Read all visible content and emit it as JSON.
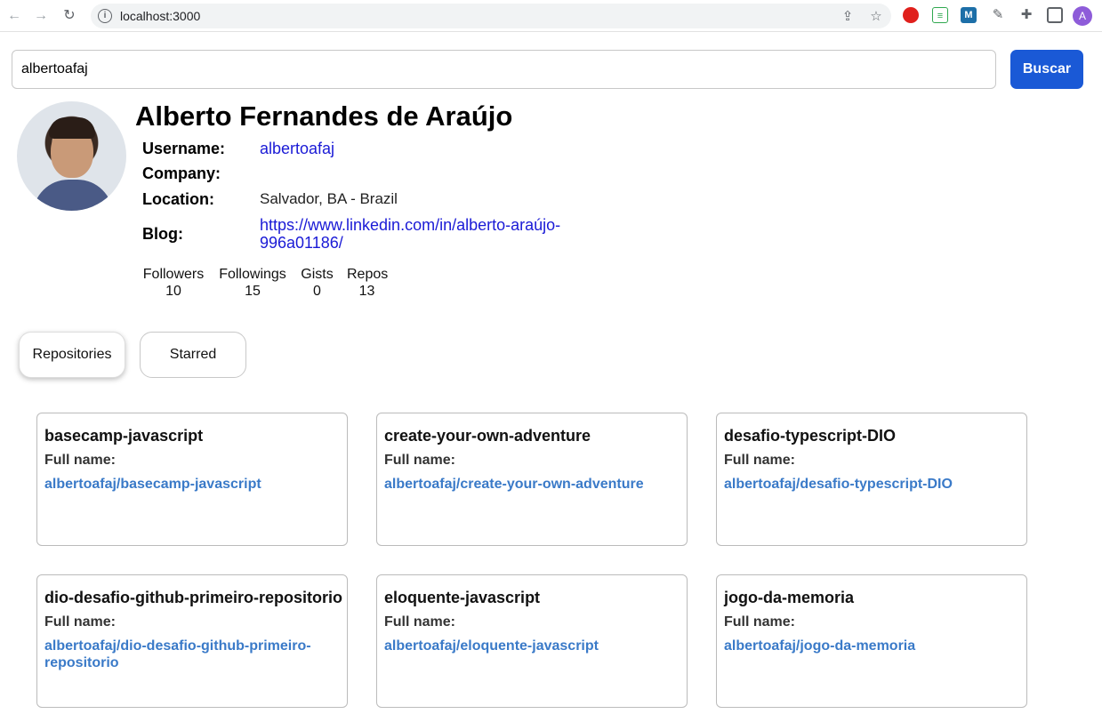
{
  "browser": {
    "url": "localhost:3000",
    "profile_initial": "A"
  },
  "search": {
    "value": "albertoafaj",
    "button_label": "Buscar"
  },
  "profile": {
    "name": "Alberto Fernandes de Araújo",
    "fields": {
      "username_label": "Username:",
      "username_value": "albertoafaj",
      "company_label": "Company:",
      "company_value": "",
      "location_label": "Location:",
      "location_value": "Salvador, BA - Brazil",
      "blog_label": "Blog:",
      "blog_value": "https://www.linkedin.com/in/alberto-araújo-996a01186/"
    },
    "stats": [
      {
        "label": "Followers",
        "value": "10"
      },
      {
        "label": "Followings",
        "value": "15"
      },
      {
        "label": "Gists",
        "value": "0"
      },
      {
        "label": "Repos",
        "value": "13"
      }
    ]
  },
  "tabs": [
    {
      "label": "Repositories",
      "active": true
    },
    {
      "label": "Starred",
      "active": false
    }
  ],
  "repos": [
    {
      "name": "basecamp-javascript",
      "full_name_label": "Full name:",
      "full_name": "albertoafaj/basecamp-javascript"
    },
    {
      "name": "create-your-own-adventure",
      "full_name_label": "Full name:",
      "full_name": "albertoafaj/create-your-own-adventure"
    },
    {
      "name": "desafio-typescript-DIO",
      "full_name_label": "Full name:",
      "full_name": "albertoafaj/desafio-typescript-DIO"
    },
    {
      "name": "dio-desafio-github-primeiro-repositorio",
      "full_name_label": "Full name:",
      "full_name": "albertoafaj/dio-desafio-github-primeiro-repositorio"
    },
    {
      "name": "eloquente-javascript",
      "full_name_label": "Full name:",
      "full_name": "albertoafaj/eloquente-javascript"
    },
    {
      "name": "jogo-da-memoria",
      "full_name_label": "Full name:",
      "full_name": "albertoafaj/jogo-da-memoria"
    }
  ]
}
